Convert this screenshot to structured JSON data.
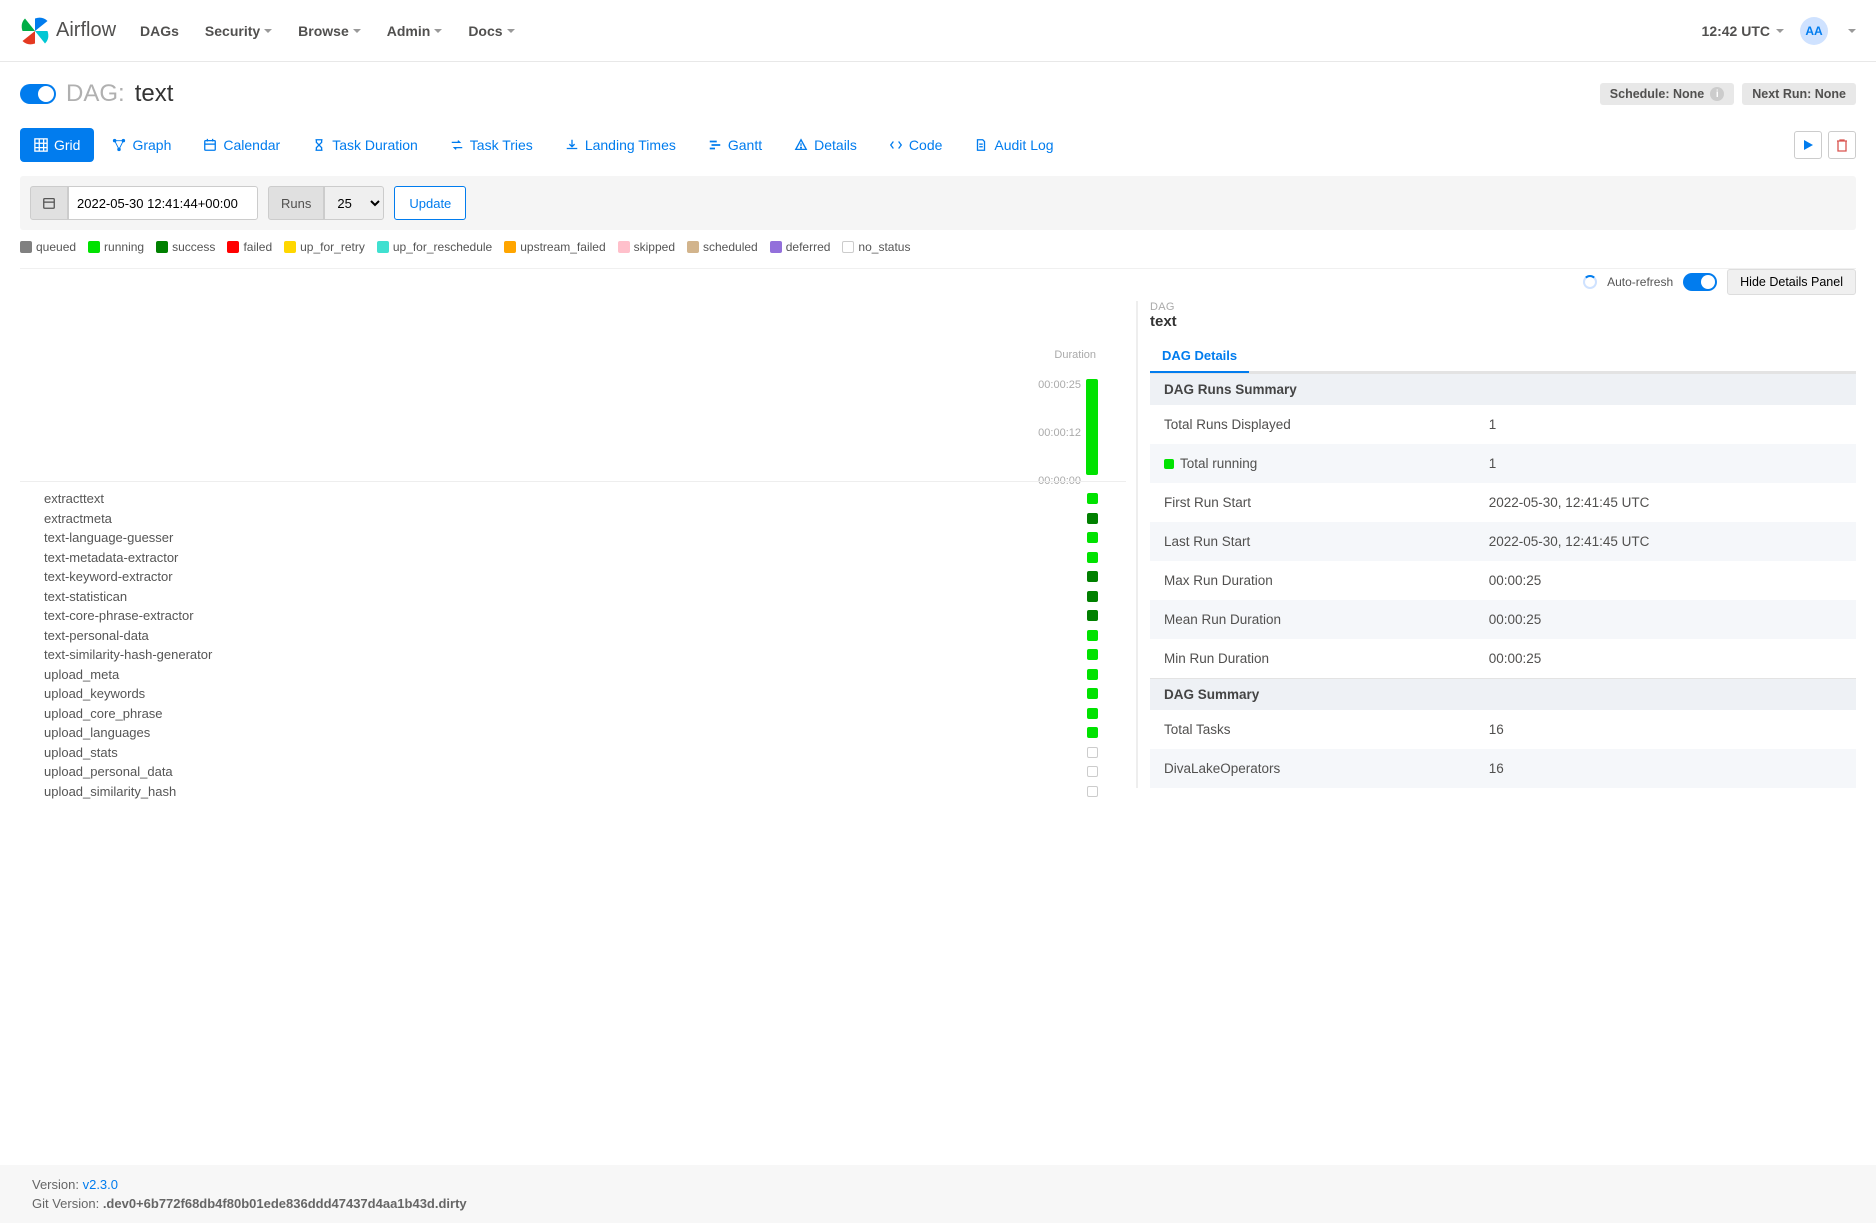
{
  "brand": "Airflow",
  "nav": {
    "dags": "DAGs",
    "security": "Security",
    "browse": "Browse",
    "admin": "Admin",
    "docs": "Docs"
  },
  "clock": "12:42 UTC",
  "avatar": "AA",
  "dag": {
    "label": "DAG:",
    "name": "text"
  },
  "schedule_badge": "Schedule: None",
  "nextrun_badge": "Next Run: None",
  "tabs": {
    "grid": "Grid",
    "graph": "Graph",
    "calendar": "Calendar",
    "taskdur": "Task Duration",
    "tasktries": "Task Tries",
    "landing": "Landing Times",
    "gantt": "Gantt",
    "details": "Details",
    "code": "Code",
    "audit": "Audit Log"
  },
  "filter": {
    "date": "2022-05-30 12:41:44+00:00",
    "runs_label": "Runs",
    "runs_sel": "25",
    "update": "Update"
  },
  "legend": {
    "queued": "queued",
    "running": "running",
    "success": "success",
    "failed": "failed",
    "retry": "up_for_retry",
    "resched": "up_for_reschedule",
    "upfail": "upstream_failed",
    "skipped": "skipped",
    "scheduled": "scheduled",
    "deferred": "deferred",
    "nostatus": "no_status"
  },
  "autorefresh": "Auto-refresh",
  "hide_panel": "Hide Details Panel",
  "grid": {
    "duration_label": "Duration",
    "y0": "00:00:25",
    "y1": "00:00:12",
    "y2": "00:00:00",
    "tasks": [
      {
        "name": "extracttext",
        "status": "running"
      },
      {
        "name": "extractmeta",
        "status": "success"
      },
      {
        "name": "text-language-guesser",
        "status": "running"
      },
      {
        "name": "text-metadata-extractor",
        "status": "running"
      },
      {
        "name": "text-keyword-extractor",
        "status": "success"
      },
      {
        "name": "text-statistican",
        "status": "success"
      },
      {
        "name": "text-core-phrase-extractor",
        "status": "success"
      },
      {
        "name": "text-personal-data",
        "status": "running"
      },
      {
        "name": "text-similarity-hash-generator",
        "status": "running"
      },
      {
        "name": "upload_meta",
        "status": "running"
      },
      {
        "name": "upload_keywords",
        "status": "running"
      },
      {
        "name": "upload_core_phrase",
        "status": "running"
      },
      {
        "name": "upload_languages",
        "status": "running"
      },
      {
        "name": "upload_stats",
        "status": "none"
      },
      {
        "name": "upload_personal_data",
        "status": "none"
      },
      {
        "name": "upload_similarity_hash",
        "status": "none"
      }
    ]
  },
  "details": {
    "small_label": "DAG",
    "title": "text",
    "tab": "DAG Details",
    "runs_hdr": "DAG Runs Summary",
    "rows": [
      {
        "k": "Total Runs Displayed",
        "v": "1"
      },
      {
        "k": "Total running",
        "v": "1",
        "dot": true
      },
      {
        "k": "First Run Start",
        "v": "2022-05-30, 12:41:45 UTC"
      },
      {
        "k": "Last Run Start",
        "v": "2022-05-30, 12:41:45 UTC"
      },
      {
        "k": "Max Run Duration",
        "v": "00:00:25"
      },
      {
        "k": "Mean Run Duration",
        "v": "00:00:25"
      },
      {
        "k": "Min Run Duration",
        "v": "00:00:25"
      }
    ],
    "summary_hdr": "DAG Summary",
    "srows": [
      {
        "k": "Total Tasks",
        "v": "16"
      },
      {
        "k": "DivaLakeOperators",
        "v": "16"
      }
    ]
  },
  "footer": {
    "version_label": "Version: ",
    "version": "v2.3.0",
    "git_label": "Git Version: ",
    "git": ".dev0+6b772f68db4f80b01ede836ddd47437d4aa1b43d.dirty"
  }
}
